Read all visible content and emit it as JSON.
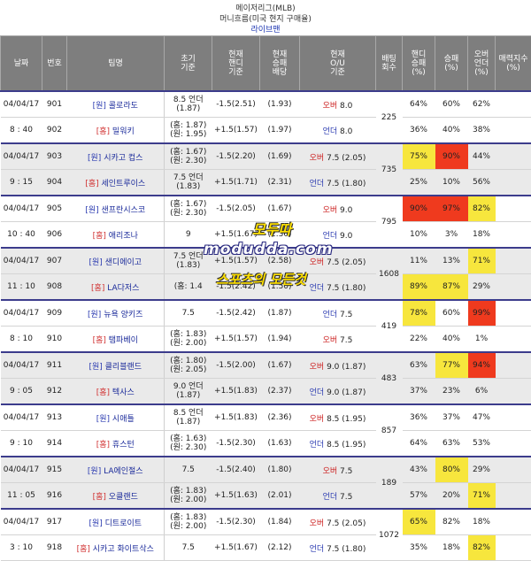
{
  "header": {
    "line1": "메이저리그(MLB)",
    "line2": "머니흐름(미국 현지 구매율)",
    "line3": "라이브맨"
  },
  "columns": {
    "date": "날짜",
    "no": "번호",
    "team": "팀명",
    "initial": [
      "초기",
      "기준"
    ],
    "handi": [
      "현재",
      "핸디",
      "기준"
    ],
    "ml": [
      "현재",
      "승패",
      "배당"
    ],
    "ou": [
      "현재",
      "O/U",
      "기준"
    ],
    "bet": [
      "배팅",
      "회수"
    ],
    "hpct": [
      "핸디",
      "승패",
      "(%)"
    ],
    "wpct": [
      "승패",
      "(%)"
    ],
    "opct": [
      "오버",
      "언더",
      "(%)"
    ],
    "charm": [
      "매력지수",
      "(%)"
    ]
  },
  "tags": {
    "home": "[홈]",
    "away": "[원]"
  },
  "watermark": {
    "w1": "모두따",
    "w2": "modudda.com",
    "w3": "스포츠의 모든것"
  },
  "rows": [
    {
      "date": "04/04/17",
      "no": "901",
      "tag": "[원]",
      "team": "콜로라도",
      "init": [
        "8.5 언더",
        "(1.87)"
      ],
      "handi": "-1.5(2.51)",
      "ml": "(1.93)",
      "ou_label": "오버",
      "ou_cls": "red",
      "ou_val": "8.0",
      "bet": "225",
      "h": "64%",
      "w": "60%",
      "o": "62%"
    },
    {
      "date": "8 : 40",
      "no": "902",
      "tag": "[홈]",
      "team": "밀워키",
      "init": [
        "(홈: 1.87)",
        "(원: 1.95)"
      ],
      "handi": "+1.5(1.57)",
      "ml": "(1.97)",
      "ou_label": "언더",
      "ou_cls": "blue",
      "ou_val": "8.0",
      "bet": "",
      "h": "36%",
      "w": "40%",
      "o": "38%"
    },
    {
      "date": "04/04/17",
      "no": "903",
      "tag": "[원]",
      "team": "시카고 컵스",
      "init": [
        "(홈: 1.67)",
        "(원: 2.30)"
      ],
      "handi": "-1.5(2.20)",
      "ml": "(1.69)",
      "ou_label": "오버",
      "ou_cls": "red",
      "ou_val": "7.5 (2.05)",
      "bet": "735",
      "h": "75%",
      "w": "90%",
      "o": "44%"
    },
    {
      "date": "9 : 15",
      "no": "904",
      "tag": "[홈]",
      "team": "세인트루이스",
      "init": [
        "7.5 언더",
        "(1.83)"
      ],
      "handi": "+1.5(1.71)",
      "ml": "(2.31)",
      "ou_label": "언더",
      "ou_cls": "blue",
      "ou_val": "7.5 (1.80)",
      "bet": "",
      "h": "25%",
      "w": "10%",
      "o": "56%"
    },
    {
      "date": "04/04/17",
      "no": "905",
      "tag": "[원]",
      "team": "샌프란시스코",
      "init": [
        "(홈: 1.67)",
        "(원: 2.30)"
      ],
      "handi": "-1.5(2.05)",
      "ml": "(1.67)",
      "ou_label": "오버",
      "ou_cls": "red",
      "ou_val": "9.0",
      "bet": "795",
      "h": "90%",
      "w": "97%",
      "o": "82%"
    },
    {
      "date": "10 : 40",
      "no": "906",
      "tag": "[홈]",
      "team": "애리조나",
      "init": [
        "9",
        ""
      ],
      "handi": "+1.5(1.67)",
      "ml": "(2.36)",
      "ou_label": "언더",
      "ou_cls": "blue",
      "ou_val": "9.0",
      "bet": "",
      "h": "10%",
      "w": "3%",
      "o": "18%"
    },
    {
      "date": "04/04/17",
      "no": "907",
      "tag": "[원]",
      "team": "샌디에이고",
      "init": [
        "7.5 언더",
        "(1.83)"
      ],
      "handi": "+1.5(1.57)",
      "ml": "(2.58)",
      "ou_label": "오버",
      "ou_cls": "red",
      "ou_val": "7.5 (2.05)",
      "bet": "1608",
      "h": "11%",
      "w": "13%",
      "o": "71%"
    },
    {
      "date": "11 : 10",
      "no": "908",
      "tag": "[홈]",
      "team": "LA다저스",
      "init": [
        "(홈: 1.4",
        ""
      ],
      "handi": "-1.5(2.42)",
      "ml": "(1.50)",
      "ou_label": "언더",
      "ou_cls": "blue",
      "ou_val": "7.5 (1.80)",
      "bet": "",
      "h": "89%",
      "w": "87%",
      "o": "29%"
    },
    {
      "date": "04/04/17",
      "no": "909",
      "tag": "[원]",
      "team": "뉴욕 양키즈",
      "init": [
        "7.5",
        ""
      ],
      "handi": "-1.5(2.42)",
      "ml": "(1.87)",
      "ou_label": "언더",
      "ou_cls": "blue",
      "ou_val": "7.5",
      "bet": "419",
      "h": "78%",
      "w": "60%",
      "o": "99%"
    },
    {
      "date": "8 : 10",
      "no": "910",
      "tag": "[홈]",
      "team": "탬파베이",
      "init": [
        "(홈: 1.83)",
        "(원: 2.00)"
      ],
      "handi": "+1.5(1.57)",
      "ml": "(1.94)",
      "ou_label": "오버",
      "ou_cls": "red",
      "ou_val": "7.5",
      "bet": "",
      "h": "22%",
      "w": "40%",
      "o": "1%"
    },
    {
      "date": "04/04/17",
      "no": "911",
      "tag": "[원]",
      "team": "클리블랜드",
      "init": [
        "(홈: 1.80)",
        "(원: 2.05)"
      ],
      "handi": "-1.5(2.00)",
      "ml": "(1.67)",
      "ou_label": "오버",
      "ou_cls": "red",
      "ou_val": "9.0 (1.87)",
      "bet": "483",
      "h": "63%",
      "w": "77%",
      "o": "94%"
    },
    {
      "date": "9 : 05",
      "no": "912",
      "tag": "[홈]",
      "team": "텍사스",
      "init": [
        "9.0 언더",
        "(1.87)"
      ],
      "handi": "+1.5(1.83)",
      "ml": "(2.37)",
      "ou_label": "언더",
      "ou_cls": "blue",
      "ou_val": "9.0 (1.87)",
      "bet": "",
      "h": "37%",
      "w": "23%",
      "o": "6%"
    },
    {
      "date": "04/04/17",
      "no": "913",
      "tag": "[원]",
      "team": "시애틀",
      "init": [
        "8.5 언더",
        "(1.87)"
      ],
      "handi": "+1.5(1.83)",
      "ml": "(2.36)",
      "ou_label": "오버",
      "ou_cls": "red",
      "ou_val": "8.5 (1.95)",
      "bet": "857",
      "h": "36%",
      "w": "37%",
      "o": "47%"
    },
    {
      "date": "9 : 10",
      "no": "914",
      "tag": "[홈]",
      "team": "휴스턴",
      "init": [
        "(홈: 1.63)",
        "(원: 2.30)"
      ],
      "handi": "-1.5(2.30)",
      "ml": "(1.63)",
      "ou_label": "언더",
      "ou_cls": "blue",
      "ou_val": "8.5 (1.95)",
      "bet": "",
      "h": "64%",
      "w": "63%",
      "o": "53%"
    },
    {
      "date": "04/04/17",
      "no": "915",
      "tag": "[원]",
      "team": "LA에인절스",
      "init": [
        "7.5",
        ""
      ],
      "handi": "-1.5(2.40)",
      "ml": "(1.80)",
      "ou_label": "오버",
      "ou_cls": "red",
      "ou_val": "7.5",
      "bet": "189",
      "h": "43%",
      "w": "80%",
      "o": "29%"
    },
    {
      "date": "11 : 05",
      "no": "916",
      "tag": "[홈]",
      "team": "오클랜드",
      "init": [
        "(홈: 1.83)",
        "(원: 2.00)"
      ],
      "handi": "+1.5(1.63)",
      "ml": "(2.01)",
      "ou_label": "언더",
      "ou_cls": "blue",
      "ou_val": "7.5",
      "bet": "",
      "h": "57%",
      "w": "20%",
      "o": "71%"
    },
    {
      "date": "04/04/17",
      "no": "917",
      "tag": "[원]",
      "team": "디트로이트",
      "init": [
        "(홈: 1.83)",
        "(원: 2.00)"
      ],
      "handi": "-1.5(2.30)",
      "ml": "(1.84)",
      "ou_label": "오버",
      "ou_cls": "red",
      "ou_val": "7.5 (2.05)",
      "bet": "1072",
      "h": "65%",
      "w": "82%",
      "o": "18%"
    },
    {
      "date": "3 : 10",
      "no": "918",
      "tag": "[홈]",
      "team": "시카고 화이트삭스",
      "init": [
        "7.5",
        ""
      ],
      "handi": "+1.5(1.67)",
      "ml": "(2.12)",
      "ou_label": "언더",
      "ou_cls": "blue",
      "ou_val": "7.5 (1.80)",
      "bet": "",
      "h": "35%",
      "w": "18%",
      "o": "82%"
    }
  ],
  "colors": {
    "yellow": "#f7e63d",
    "red": "#ef3a1e",
    "header": "#7e7e7e"
  }
}
